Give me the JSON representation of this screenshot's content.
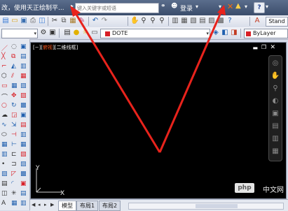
{
  "titlebar": {
    "title_text": "改，使用天正绘制平...",
    "search_placeholder": "键入关键字或短语",
    "login_label": "登录",
    "help_label": "?"
  },
  "toolbar1": {
    "workspace_label": "Stand"
  },
  "toolbar2": {
    "layer_name": "DOTE",
    "color_label": "ByLayer"
  },
  "viewport": {
    "label_prefix": "[−][",
    "label_view": "俯视",
    "label_suffix": "][二维线框]",
    "ucs_y": "Y",
    "ucs_x": "X"
  },
  "tabs": {
    "items": [
      "模型",
      "布局1",
      "布局2"
    ]
  },
  "watermark": {
    "badge": "php",
    "text": "中文网"
  },
  "colors": {
    "arrow": "#e8231c",
    "viewport_bg": "#000000",
    "titlebar": "#3b4d6b"
  }
}
